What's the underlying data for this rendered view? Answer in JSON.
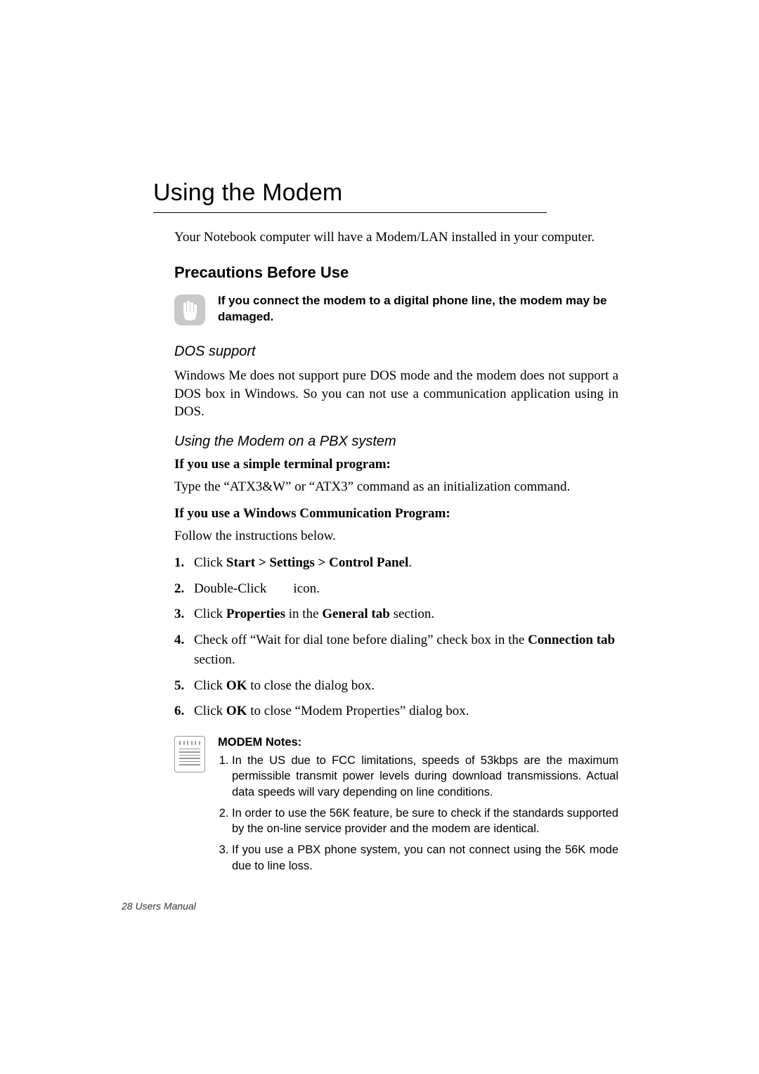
{
  "title": "Using the Modem",
  "intro": "Your Notebook computer will have a Modem/LAN installed in your computer.",
  "h2": "Precautions Before Use",
  "warn_text": "If you connect the modem to a digital phone line, the modem may be damaged.",
  "dos": {
    "heading": "DOS support",
    "text": "Windows Me does not support pure DOS mode and the modem does not support a DOS box in Windows. So you can not use a communication application using in DOS."
  },
  "pbx": {
    "heading": "Using the Modem on a PBX system",
    "sub1": "If you use a simple terminal program:",
    "cmd_text": "Type the “ATX3&W” or “ATX3” command as an initialization command.",
    "sub2": "If you use a Windows Communication Program:",
    "follow": "Follow the instructions below."
  },
  "steps": {
    "s1": {
      "pre": "Click ",
      "b1": "Start > Settings > Control Panel",
      "post": "."
    },
    "s2": {
      "pre": "Double-Click  icon."
    },
    "s3": {
      "pre": "Click ",
      "b1": "Properties",
      "mid": " in the ",
      "b2": "General tab",
      "post": " section."
    },
    "s4": {
      "pre": "Check off “Wait for dial tone before dialing” check box in the ",
      "b1": "Connection tab",
      "post": " section."
    },
    "s5": {
      "pre": "Click ",
      "b1": "OK",
      "post": " to close the dialog box."
    },
    "s6": {
      "pre": "Click ",
      "b1": "OK",
      "post": " to close “Modem Properties” dialog box."
    }
  },
  "notes": {
    "title": "MODEM Notes:",
    "items": [
      "In the US due to FCC limitations, speeds of 53kbps are the maximum permissible transmit power levels during download transmissions. Actual data speeds will vary depending on line conditions.",
      "In order to use the 56K feature, be sure to check if the standards supported by the on-line service provider and the modem are identical.",
      "If you use a PBX phone system, you can not connect using the 56K mode due to line loss."
    ]
  },
  "footer": "28  Users Manual"
}
